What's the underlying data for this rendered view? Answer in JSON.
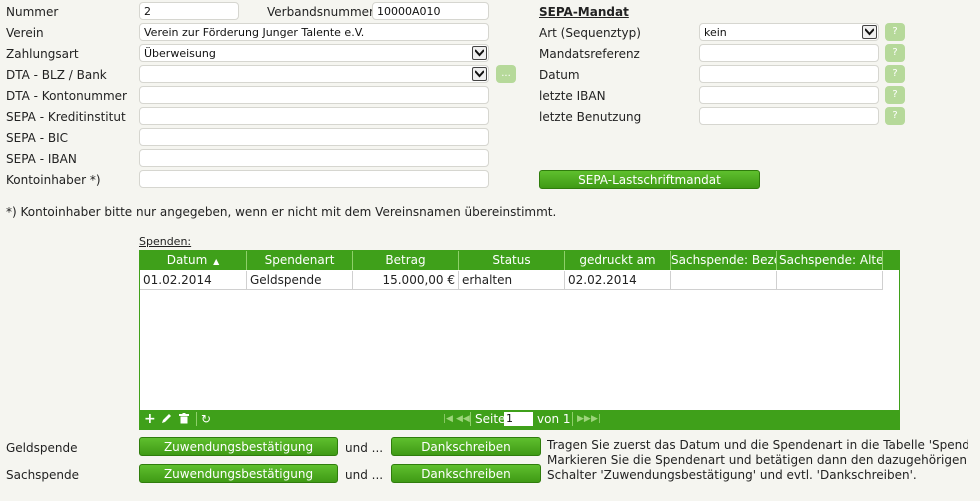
{
  "left_form": {
    "nummer": {
      "label": "Nummer",
      "value": "2"
    },
    "verbandsnummer": {
      "label": "Verbandsnummer",
      "value": "10000A010"
    },
    "verein": {
      "label": "Verein",
      "value": "Verein zur Förderung Junger Talente e.V."
    },
    "zahlungsart": {
      "label": "Zahlungsart",
      "value": "Überweisung"
    },
    "dta_blz": {
      "label": "DTA - BLZ / Bank",
      "value": "",
      "button": "..."
    },
    "dta_konto": {
      "label": "DTA - Kontonummer",
      "value": ""
    },
    "sepa_kredit": {
      "label": "SEPA - Kreditinstitut",
      "value": ""
    },
    "sepa_bic": {
      "label": "SEPA - BIC",
      "value": ""
    },
    "sepa_iban": {
      "label": "SEPA - IBAN",
      "value": ""
    },
    "kontoinhaber": {
      "label": "Kontoinhaber *)",
      "value": ""
    }
  },
  "sepa": {
    "title": "SEPA-Mandat",
    "art": {
      "label": "Art (Sequenztyp)",
      "value": "kein"
    },
    "mandatsreferenz": {
      "label": "Mandatsreferenz",
      "value": ""
    },
    "datum": {
      "label": "Datum",
      "value": ""
    },
    "letzte_iban": {
      "label": "letzte IBAN",
      "value": ""
    },
    "letzte_benutzung": {
      "label": "letzte Benutzung",
      "value": ""
    },
    "help": "?",
    "button": "SEPA-Lastschriftmandat"
  },
  "note": "*) Kontoinhaber bitte nur angegeben, wenn er nicht mit dem Vereinsnamen übereinstimmt.",
  "spenden": {
    "caption": "Spenden:",
    "columns": [
      "Datum",
      "Spendenart",
      "Betrag",
      "Status",
      "gedruckt am",
      "Sachspende: Beze",
      "Sachspende: Alte"
    ],
    "rows": [
      [
        "01.02.2014",
        "Geldspende",
        "15.000,00 €",
        "erhalten",
        "02.02.2014",
        "",
        ""
      ]
    ],
    "pager": {
      "seite": "Seite",
      "page": "1",
      "von": "von 1"
    }
  },
  "actions": {
    "geld_label": "Geldspende",
    "sach_label": "Sachspende",
    "zuwendung": "Zuwendungsbestätigung",
    "und": "und ...",
    "dank": "Dankschreiben",
    "hint1": "Tragen Sie zuerst das Datum und die Spendenart in die Tabelle 'Spenden' ein.",
    "hint2": "Markieren Sie die Spendenart und betätigen dann den dazugehörigen",
    "hint3": "Schalter 'Zuwendungsbestätigung' und evtl. 'Dankschreiben'."
  },
  "colors": {
    "accent": "#3fa01a",
    "help_btn": "#b6d99a"
  }
}
